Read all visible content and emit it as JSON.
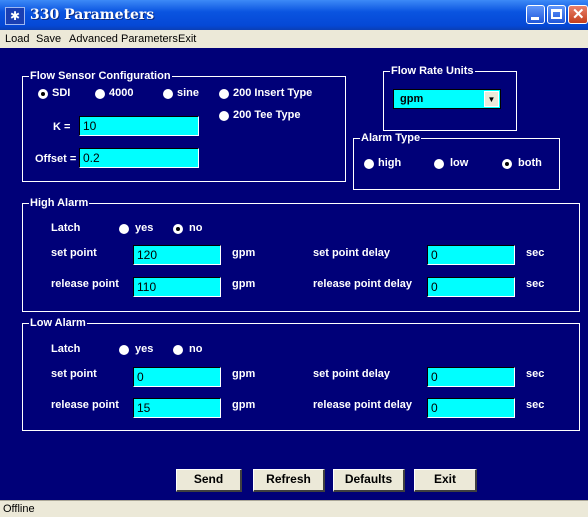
{
  "window": {
    "title": "330 Parameters"
  },
  "menu": {
    "load": "Load",
    "save": "Save",
    "advanced": "Advanced Parameters",
    "exit": "Exit"
  },
  "flow_sensor": {
    "title": "Flow Sensor Configuration",
    "options": [
      "SDI",
      "4000",
      "sine",
      "200 Insert Type",
      "200 Tee Type"
    ],
    "selected": "SDI",
    "k_label": "K =",
    "k_value": "10",
    "offset_label": "Offset =",
    "offset_value": "0.2"
  },
  "flow_rate_units": {
    "title": "Flow Rate Units",
    "value": "gpm"
  },
  "alarm_type": {
    "title": "Alarm Type",
    "options": [
      "high",
      "low",
      "both"
    ],
    "selected": "both"
  },
  "high_alarm": {
    "title": "High Alarm",
    "latch_label": "Latch",
    "yes": "yes",
    "no": "no",
    "latch_selected": "no",
    "set_point_label": "set point",
    "set_point": "120",
    "set_point_unit": "gpm",
    "release_point_label": "release point",
    "release_point": "110",
    "release_point_unit": "gpm",
    "set_delay_label": "set point delay",
    "set_delay": "0",
    "set_delay_unit": "sec",
    "release_delay_label": "release point delay",
    "release_delay": "0",
    "release_delay_unit": "sec"
  },
  "low_alarm": {
    "title": "Low Alarm",
    "latch_label": "Latch",
    "yes": "yes",
    "no": "no",
    "latch_selected": "none",
    "set_point_label": "set point",
    "set_point": "0",
    "set_point_unit": "gpm",
    "release_point_label": "release point",
    "release_point": "15",
    "release_point_unit": "gpm",
    "set_delay_label": "set point delay",
    "set_delay": "0",
    "set_delay_unit": "sec",
    "release_delay_label": "release point delay",
    "release_delay": "0",
    "release_delay_unit": "sec"
  },
  "buttons": {
    "send": "Send",
    "refresh": "Refresh",
    "defaults": "Defaults",
    "exit": "Exit"
  },
  "status": {
    "text": "Offline"
  }
}
